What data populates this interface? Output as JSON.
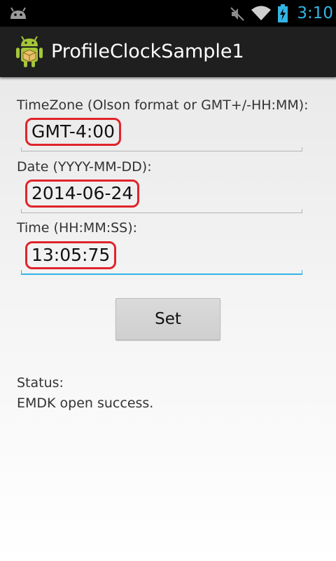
{
  "status_bar": {
    "time": "3:10",
    "icons": [
      "android-notification-icon",
      "mute-icon",
      "wifi-icon",
      "battery-charging-icon"
    ],
    "accent_color": "#33b5e5"
  },
  "action_bar": {
    "title": "ProfileClockSample1",
    "icon": "android-app-icon"
  },
  "form": {
    "timezone": {
      "label": "TimeZone (Olson format or GMT+/-HH:MM):",
      "value": "GMT-4:00"
    },
    "date": {
      "label": "Date (YYYY-MM-DD):",
      "value": "2014-06-24"
    },
    "time": {
      "label": "Time (HH:MM:SS):",
      "value": "13:05:75"
    },
    "set_label": "Set"
  },
  "status": {
    "label": "Status:",
    "message": "EMDK open success."
  },
  "colors": {
    "highlight": "#e0242b",
    "focus": "#33b5e5"
  }
}
